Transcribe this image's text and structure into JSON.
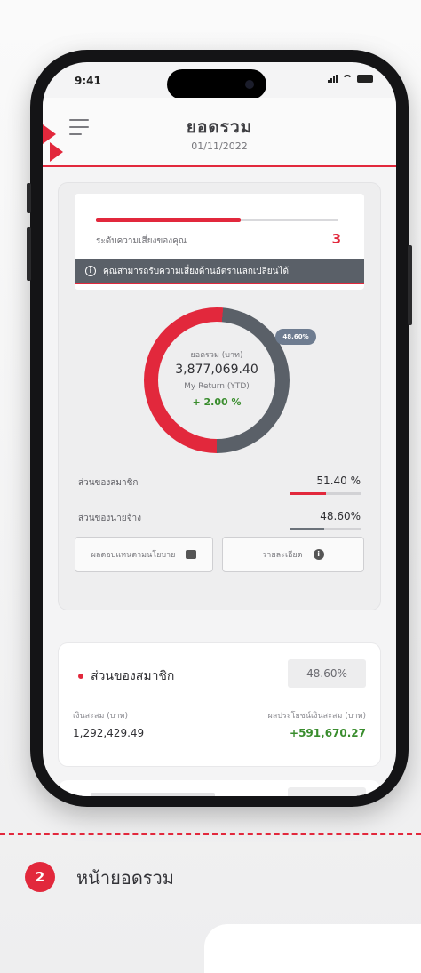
{
  "status_bar": {
    "time": "9:41"
  },
  "header": {
    "title": "ยอดรวม",
    "date": "01/11/2022"
  },
  "risk": {
    "level_fraction": 0.6,
    "label": "ระดับความเสี่ยงของคุณ",
    "value": "3",
    "warning": "คุณสามารถรับความเสี่ยงด้านอัตราแลกเปลี่ยนได้"
  },
  "summary": {
    "badge": "48.60%",
    "total_label": "ยอดรวม (บาท)",
    "total_value": "3,877,069.40",
    "return_label": "My Return (YTD)",
    "return_value": "+ 2.00 %",
    "member_share_fraction": 0.514
  },
  "splits": [
    {
      "label": "ส่วนของสมาชิก",
      "value": "51.40  %",
      "fraction": 0.514,
      "color": "#e2283c"
    },
    {
      "label": "ส่วนของนายจ้าง",
      "value": "48.60%",
      "fraction": 0.486,
      "color": "#6b727a"
    }
  ],
  "buttons": {
    "left": "ผลตอบแทนตามนโยบาย",
    "right": "รายละเอียด"
  },
  "member_card": {
    "title": "ส่วนของสมาชิก",
    "badge": "48.60%",
    "left_label": "เงินสะสม (บาท)",
    "right_label": "ผลประโยชน์เงินสะสม (บาท)",
    "left_value": "1,292,429.49",
    "right_value": "+591,670.27"
  },
  "caption": {
    "step": "2",
    "title": "หน้ายอดรวม"
  },
  "colors": {
    "accent": "#e2283c",
    "gray": "#5a6068",
    "positive": "#3a8d2e"
  }
}
